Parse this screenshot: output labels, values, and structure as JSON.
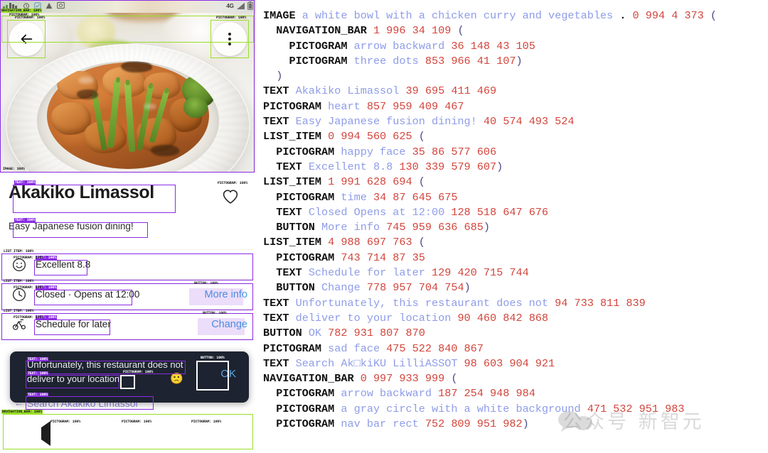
{
  "phone": {
    "status_bar": {
      "network": "4G",
      "icons": [
        "signal-icon",
        "wifi-icon",
        "alarm-icon",
        "location-icon",
        "warning-icon",
        "photo-icon",
        "battery-icon"
      ]
    },
    "hero": {
      "alt": "a white bowl with a chicken curry and vegetables",
      "back_icon": "arrow-backward",
      "menu_icon": "three-dots"
    },
    "title": "Akakiko Limassol",
    "subtitle": "Easy Japanese fusion dining!",
    "favorite_icon": "heart",
    "rows": [
      {
        "icon": "happy-face",
        "text": "Excellent 8.8",
        "action": ""
      },
      {
        "icon": "time",
        "text": "Closed · Opens at 12:00",
        "action": "More info"
      },
      {
        "icon": "schedule",
        "text": "Schedule for later",
        "action": "Change"
      }
    ],
    "snackbar": {
      "line1": "Unfortunately, this restaurant does not",
      "line2": "deliver to your location",
      "emoji": "sad-face",
      "ok": "OK"
    },
    "search_text": "Search Akakiko Limassol",
    "bottom_nav": {
      "back": "arrow-backward",
      "home": "a gray circle with a white background",
      "recents": "nav bar rect"
    }
  },
  "annotations": {
    "labels": {
      "navigation_bar": "NAVIGATION_BAR: 100%",
      "pictogram": "PICTOGRAM: 100%",
      "image": "IMAGE: 100%",
      "text": "TEXT: 100%",
      "list_item": "LIST_ITEM: 100%",
      "button": "BUTTON: 100%"
    }
  },
  "panel": {
    "lines": [
      [
        {
          "t": "tag",
          "v": "IMAGE "
        },
        {
          "t": "lit",
          "v": "a white bowl with a chicken curry and vegetables "
        },
        {
          "t": "tag",
          "v": ". "
        },
        {
          "t": "num",
          "v": "0 994 4 373 "
        },
        {
          "t": "paren",
          "v": "("
        }
      ],
      [
        {
          "t": "tag",
          "v": "  NAVIGATION_BAR "
        },
        {
          "t": "num",
          "v": "1 996 34 109 "
        },
        {
          "t": "paren",
          "v": "("
        }
      ],
      [
        {
          "t": "tag",
          "v": "    PICTOGRAM "
        },
        {
          "t": "lit",
          "v": "arrow backward "
        },
        {
          "t": "num",
          "v": "36 148 43 105"
        }
      ],
      [
        {
          "t": "tag",
          "v": "    PICTOGRAM "
        },
        {
          "t": "lit",
          "v": "three dots "
        },
        {
          "t": "num",
          "v": "853 966 41 107"
        },
        {
          "t": "paren",
          "v": ")"
        }
      ],
      [
        {
          "t": "paren",
          "v": "  )"
        }
      ],
      [
        {
          "t": "tag",
          "v": "TEXT "
        },
        {
          "t": "lit",
          "v": "Akakiko Limassol "
        },
        {
          "t": "num",
          "v": "39 695 411 469"
        }
      ],
      [
        {
          "t": "tag",
          "v": "PICTOGRAM "
        },
        {
          "t": "lit",
          "v": "heart "
        },
        {
          "t": "num",
          "v": "857 959 409 467"
        }
      ],
      [
        {
          "t": "tag",
          "v": "TEXT "
        },
        {
          "t": "lit",
          "v": "Easy Japanese fusion dining! "
        },
        {
          "t": "num",
          "v": "40 574 493 524"
        }
      ],
      [
        {
          "t": "tag",
          "v": "LIST_ITEM "
        },
        {
          "t": "num",
          "v": "0 994 560 625 "
        },
        {
          "t": "paren",
          "v": "("
        }
      ],
      [
        {
          "t": "tag",
          "v": "  PICTOGRAM "
        },
        {
          "t": "lit",
          "v": "happy face "
        },
        {
          "t": "num",
          "v": "35 86 577 606"
        }
      ],
      [
        {
          "t": "tag",
          "v": "  TEXT "
        },
        {
          "t": "lit",
          "v": "Excellent 8.8 "
        },
        {
          "t": "num",
          "v": "130 339 579 607"
        },
        {
          "t": "paren",
          "v": ")"
        }
      ],
      [
        {
          "t": "tag",
          "v": "LIST_ITEM "
        },
        {
          "t": "num",
          "v": "1 991 628 694 "
        },
        {
          "t": "paren",
          "v": "("
        }
      ],
      [
        {
          "t": "tag",
          "v": "  PICTOGRAM "
        },
        {
          "t": "lit",
          "v": "time "
        },
        {
          "t": "num",
          "v": "34 87 645 675"
        }
      ],
      [
        {
          "t": "tag",
          "v": "  TEXT "
        },
        {
          "t": "lit",
          "v": "Closed Opens at 12:00 "
        },
        {
          "t": "num",
          "v": "128 518 647 676"
        }
      ],
      [
        {
          "t": "tag",
          "v": "  BUTTON "
        },
        {
          "t": "lit",
          "v": "More info "
        },
        {
          "t": "num",
          "v": "745 959 636 685"
        },
        {
          "t": "paren",
          "v": ")"
        }
      ],
      [
        {
          "t": "tag",
          "v": "LIST_ITEM "
        },
        {
          "t": "num",
          "v": "4 988 697 763 "
        },
        {
          "t": "paren",
          "v": "("
        }
      ],
      [
        {
          "t": "tag",
          "v": "  PICTOGRAM "
        },
        {
          "t": "num",
          "v": "743 714 87 35"
        }
      ],
      [
        {
          "t": "tag",
          "v": "  TEXT "
        },
        {
          "t": "lit",
          "v": "Schedule for later "
        },
        {
          "t": "num",
          "v": "129 420 715 744"
        }
      ],
      [
        {
          "t": "tag",
          "v": "  BUTTON "
        },
        {
          "t": "lit",
          "v": "Change "
        },
        {
          "t": "num",
          "v": "778 957 704 754"
        },
        {
          "t": "paren",
          "v": ")"
        }
      ],
      [
        {
          "t": "tag",
          "v": "TEXT "
        },
        {
          "t": "lit",
          "v": "Unfortunately, this restaurant does not "
        },
        {
          "t": "num",
          "v": "94 733 811 839"
        }
      ],
      [
        {
          "t": "tag",
          "v": "TEXT "
        },
        {
          "t": "lit",
          "v": "deliver to your location "
        },
        {
          "t": "num",
          "v": "90 460 842 868"
        }
      ],
      [
        {
          "t": "tag",
          "v": "BUTTON "
        },
        {
          "t": "lit",
          "v": "OK "
        },
        {
          "t": "num",
          "v": "782 931 807 870"
        }
      ],
      [
        {
          "t": "tag",
          "v": "PICTOGRAM "
        },
        {
          "t": "lit",
          "v": "sad face "
        },
        {
          "t": "num",
          "v": "475 522 840 867"
        }
      ],
      [
        {
          "t": "tag",
          "v": "TEXT "
        },
        {
          "t": "lit",
          "v": "Search Ak□kiKU LilliASSOT "
        },
        {
          "t": "num",
          "v": "98 603 904 921"
        }
      ],
      [
        {
          "t": "tag",
          "v": "NAVIGATION_BAR "
        },
        {
          "t": "num",
          "v": "0 997 933 999 "
        },
        {
          "t": "paren",
          "v": "("
        }
      ],
      [
        {
          "t": "tag",
          "v": "  PICTOGRAM "
        },
        {
          "t": "lit",
          "v": "arrow backward "
        },
        {
          "t": "num",
          "v": "187 254 948 984"
        }
      ],
      [
        {
          "t": "tag",
          "v": "  PICTOGRAM "
        },
        {
          "t": "lit",
          "v": "a gray circle with a white background "
        },
        {
          "t": "num",
          "v": "471 532 951 983"
        }
      ],
      [
        {
          "t": "tag",
          "v": "  PICTOGRAM "
        },
        {
          "t": "lit",
          "v": "nav bar rect "
        },
        {
          "t": "num",
          "v": "752 809 951 982"
        },
        {
          "t": "paren",
          "v": ")"
        }
      ]
    ]
  },
  "watermark": "公众号 新智元"
}
